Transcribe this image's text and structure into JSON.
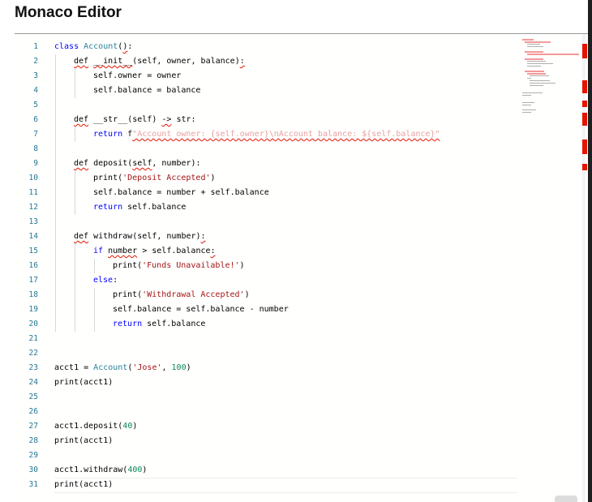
{
  "page": {
    "title": "Monaco Editor"
  },
  "editor": {
    "lines": [
      {
        "n": "1",
        "indent": 0,
        "tokens": [
          {
            "t": "class ",
            "c": "kw"
          },
          {
            "t": "Account",
            "c": "cls"
          },
          {
            "t": "(",
            "c": ""
          },
          {
            "t": ")",
            "c": "err"
          },
          {
            "t": ":",
            "c": ""
          }
        ]
      },
      {
        "n": "2",
        "indent": 1,
        "tokens": [
          {
            "t": "def",
            "c": "err"
          },
          {
            "t": " ",
            "c": ""
          },
          {
            "t": "__init__",
            "c": "err"
          },
          {
            "t": "(self, owner, balance)",
            "c": ""
          },
          {
            "t": ":",
            "c": "err"
          }
        ]
      },
      {
        "n": "3",
        "indent": 2,
        "tokens": [
          {
            "t": "self.owner = owner",
            "c": ""
          }
        ]
      },
      {
        "n": "4",
        "indent": 2,
        "tokens": [
          {
            "t": "self.balance = balance",
            "c": ""
          }
        ]
      },
      {
        "n": "5",
        "indent": 1,
        "tokens": []
      },
      {
        "n": "6",
        "indent": 1,
        "tokens": [
          {
            "t": "def",
            "c": "err"
          },
          {
            "t": " __str__(self) ",
            "c": ""
          },
          {
            "t": "->",
            "c": "err"
          },
          {
            "t": " str:",
            "c": ""
          }
        ]
      },
      {
        "n": "7",
        "indent": 2,
        "tokens": [
          {
            "t": "return",
            "c": "kw"
          },
          {
            "t": " f",
            "c": ""
          },
          {
            "t": "\"Account owner: {self.owner}\\nAccount balance: ${self.balance}\"",
            "c": "fstr err"
          }
        ]
      },
      {
        "n": "8",
        "indent": 1,
        "tokens": []
      },
      {
        "n": "9",
        "indent": 1,
        "tokens": [
          {
            "t": "def",
            "c": "err"
          },
          {
            "t": " deposit",
            "c": ""
          },
          {
            "t": "(",
            "c": ""
          },
          {
            "t": "self",
            "c": "err"
          },
          {
            "t": ", number):",
            "c": ""
          }
        ]
      },
      {
        "n": "10",
        "indent": 2,
        "tokens": [
          {
            "t": "print(",
            "c": ""
          },
          {
            "t": "'Deposit Accepted'",
            "c": "str"
          },
          {
            "t": ")",
            "c": ""
          }
        ]
      },
      {
        "n": "11",
        "indent": 2,
        "tokens": [
          {
            "t": "self.balance = number + self.balance",
            "c": ""
          }
        ]
      },
      {
        "n": "12",
        "indent": 2,
        "tokens": [
          {
            "t": "return",
            "c": "kw"
          },
          {
            "t": " self.balance",
            "c": ""
          }
        ]
      },
      {
        "n": "13",
        "indent": 1,
        "tokens": []
      },
      {
        "n": "14",
        "indent": 1,
        "tokens": [
          {
            "t": "def",
            "c": "err"
          },
          {
            "t": " withdraw(self, number)",
            "c": ""
          },
          {
            "t": ":",
            "c": "err"
          }
        ]
      },
      {
        "n": "15",
        "indent": 2,
        "tokens": [
          {
            "t": "if",
            "c": "kw"
          },
          {
            "t": " ",
            "c": ""
          },
          {
            "t": "number",
            "c": "err"
          },
          {
            "t": " > self.balance",
            "c": ""
          },
          {
            "t": ":",
            "c": "err"
          }
        ]
      },
      {
        "n": "16",
        "indent": 3,
        "tokens": [
          {
            "t": "print(",
            "c": ""
          },
          {
            "t": "'Funds Unavailable!'",
            "c": "str"
          },
          {
            "t": ")",
            "c": ""
          }
        ]
      },
      {
        "n": "17",
        "indent": 2,
        "tokens": [
          {
            "t": "else",
            "c": "kw"
          },
          {
            "t": ":",
            "c": ""
          }
        ]
      },
      {
        "n": "18",
        "indent": 3,
        "tokens": [
          {
            "t": "print(",
            "c": ""
          },
          {
            "t": "'Withdrawal Accepted'",
            "c": "str"
          },
          {
            "t": ")",
            "c": ""
          }
        ]
      },
      {
        "n": "19",
        "indent": 3,
        "tokens": [
          {
            "t": "self.balance = self.balance - number",
            "c": ""
          }
        ]
      },
      {
        "n": "20",
        "indent": 3,
        "tokens": [
          {
            "t": "return",
            "c": "kw"
          },
          {
            "t": " self.balance",
            "c": ""
          }
        ]
      },
      {
        "n": "21",
        "indent": 0,
        "tokens": []
      },
      {
        "n": "22",
        "indent": 0,
        "tokens": []
      },
      {
        "n": "23",
        "indent": 0,
        "tokens": [
          {
            "t": "acct1 = ",
            "c": ""
          },
          {
            "t": "Account",
            "c": "cls"
          },
          {
            "t": "(",
            "c": ""
          },
          {
            "t": "'Jose'",
            "c": "str"
          },
          {
            "t": ", ",
            "c": ""
          },
          {
            "t": "100",
            "c": "num"
          },
          {
            "t": ")",
            "c": ""
          }
        ]
      },
      {
        "n": "24",
        "indent": 0,
        "tokens": [
          {
            "t": "print(acct1)",
            "c": ""
          }
        ]
      },
      {
        "n": "25",
        "indent": 0,
        "tokens": []
      },
      {
        "n": "26",
        "indent": 0,
        "tokens": []
      },
      {
        "n": "27",
        "indent": 0,
        "tokens": [
          {
            "t": "acct1.deposit(",
            "c": ""
          },
          {
            "t": "40",
            "c": "num"
          },
          {
            "t": ")",
            "c": ""
          }
        ]
      },
      {
        "n": "28",
        "indent": 0,
        "tokens": [
          {
            "t": "print(acct1)",
            "c": ""
          }
        ]
      },
      {
        "n": "29",
        "indent": 0,
        "tokens": []
      },
      {
        "n": "30",
        "indent": 0,
        "tokens": [
          {
            "t": "acct1.withdraw(",
            "c": ""
          },
          {
            "t": "400",
            "c": "num"
          },
          {
            "t": ")",
            "c": ""
          }
        ]
      },
      {
        "n": "31",
        "indent": 0,
        "tokens": [
          {
            "t": "print(acct1)",
            "c": ""
          }
        ]
      }
    ],
    "current_line": "31"
  },
  "colors": {
    "keyword": "#0000ff",
    "string": "#a31515",
    "number": "#098658",
    "class_name": "#267f99",
    "line_number": "#237893",
    "error_squiggle": "#e51400"
  }
}
